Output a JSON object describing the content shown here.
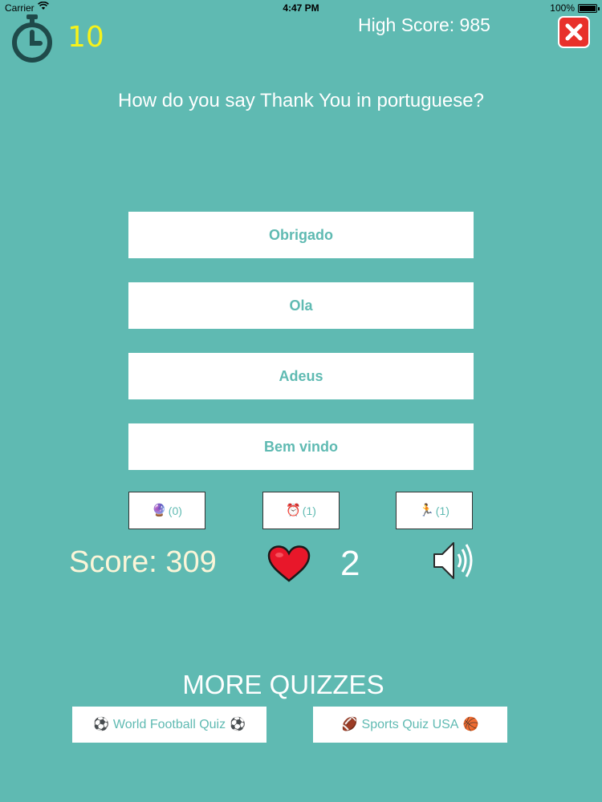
{
  "status_bar": {
    "carrier": "Carrier",
    "time": "4:47 PM",
    "battery": "100%"
  },
  "header": {
    "timer": "10",
    "high_score": "High Score: 985"
  },
  "question": "How do you say Thank You in portuguese?",
  "answers": [
    "Obrigado",
    "Ola",
    "Adeus",
    "Bem vindo"
  ],
  "lifelines": [
    {
      "icon": "crystal-ball-icon",
      "glyph": "🔮",
      "count": "(0)"
    },
    {
      "icon": "alarm-clock-icon",
      "glyph": "⏰",
      "count": "(1)"
    },
    {
      "icon": "runner-icon",
      "glyph": "🏃",
      "count": "(1)"
    }
  ],
  "stats": {
    "score": "Score: 309",
    "lives": "2"
  },
  "more_quizzes": {
    "title": "MORE QUIZZES",
    "links": [
      {
        "label": "World Football Quiz",
        "icon": "soccer-ball-icon",
        "glyph": "⚽"
      },
      {
        "label": "Sports Quiz USA",
        "icon_left": "american-football-icon",
        "glyph_left": "🏈",
        "icon_right": "basketball-icon",
        "glyph_right": "🏀"
      }
    ]
  },
  "colors": {
    "background": "#5fbab2",
    "timer": "#f6f21a",
    "close_button": "#e8312b",
    "heart": "#e8172a"
  }
}
